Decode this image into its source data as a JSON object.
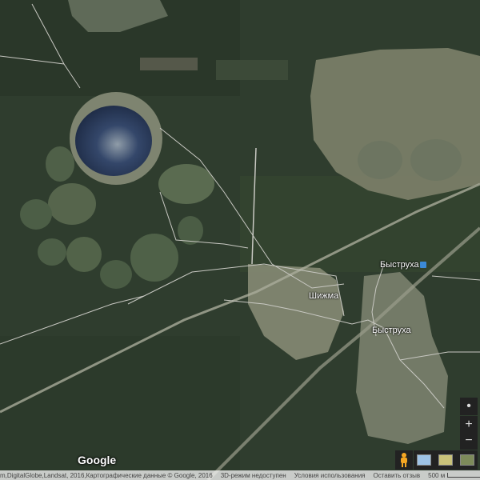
{
  "map": {
    "labels": {
      "shizhma": "Шижма",
      "bystrukha_station": "Быструха",
      "bystrukha_village": "Быструха"
    }
  },
  "branding": {
    "logo": "Google"
  },
  "controls": {
    "locate_icon": "•",
    "zoom_in": "+",
    "zoom_out": "−"
  },
  "footer": {
    "attribution": "m,DigitalGlobe,Landsat, 2016,Картографические данные © Google, 2016",
    "mode_3d": "3D-режим недоступен",
    "terms": "Условия использования",
    "feedback": "Оставить отзыв",
    "scale": "500 м"
  },
  "colors": {
    "forest": "#2f3d2e",
    "clearing": "#8b8e78",
    "lake": "#25344e",
    "road": "#c8c8c2"
  }
}
